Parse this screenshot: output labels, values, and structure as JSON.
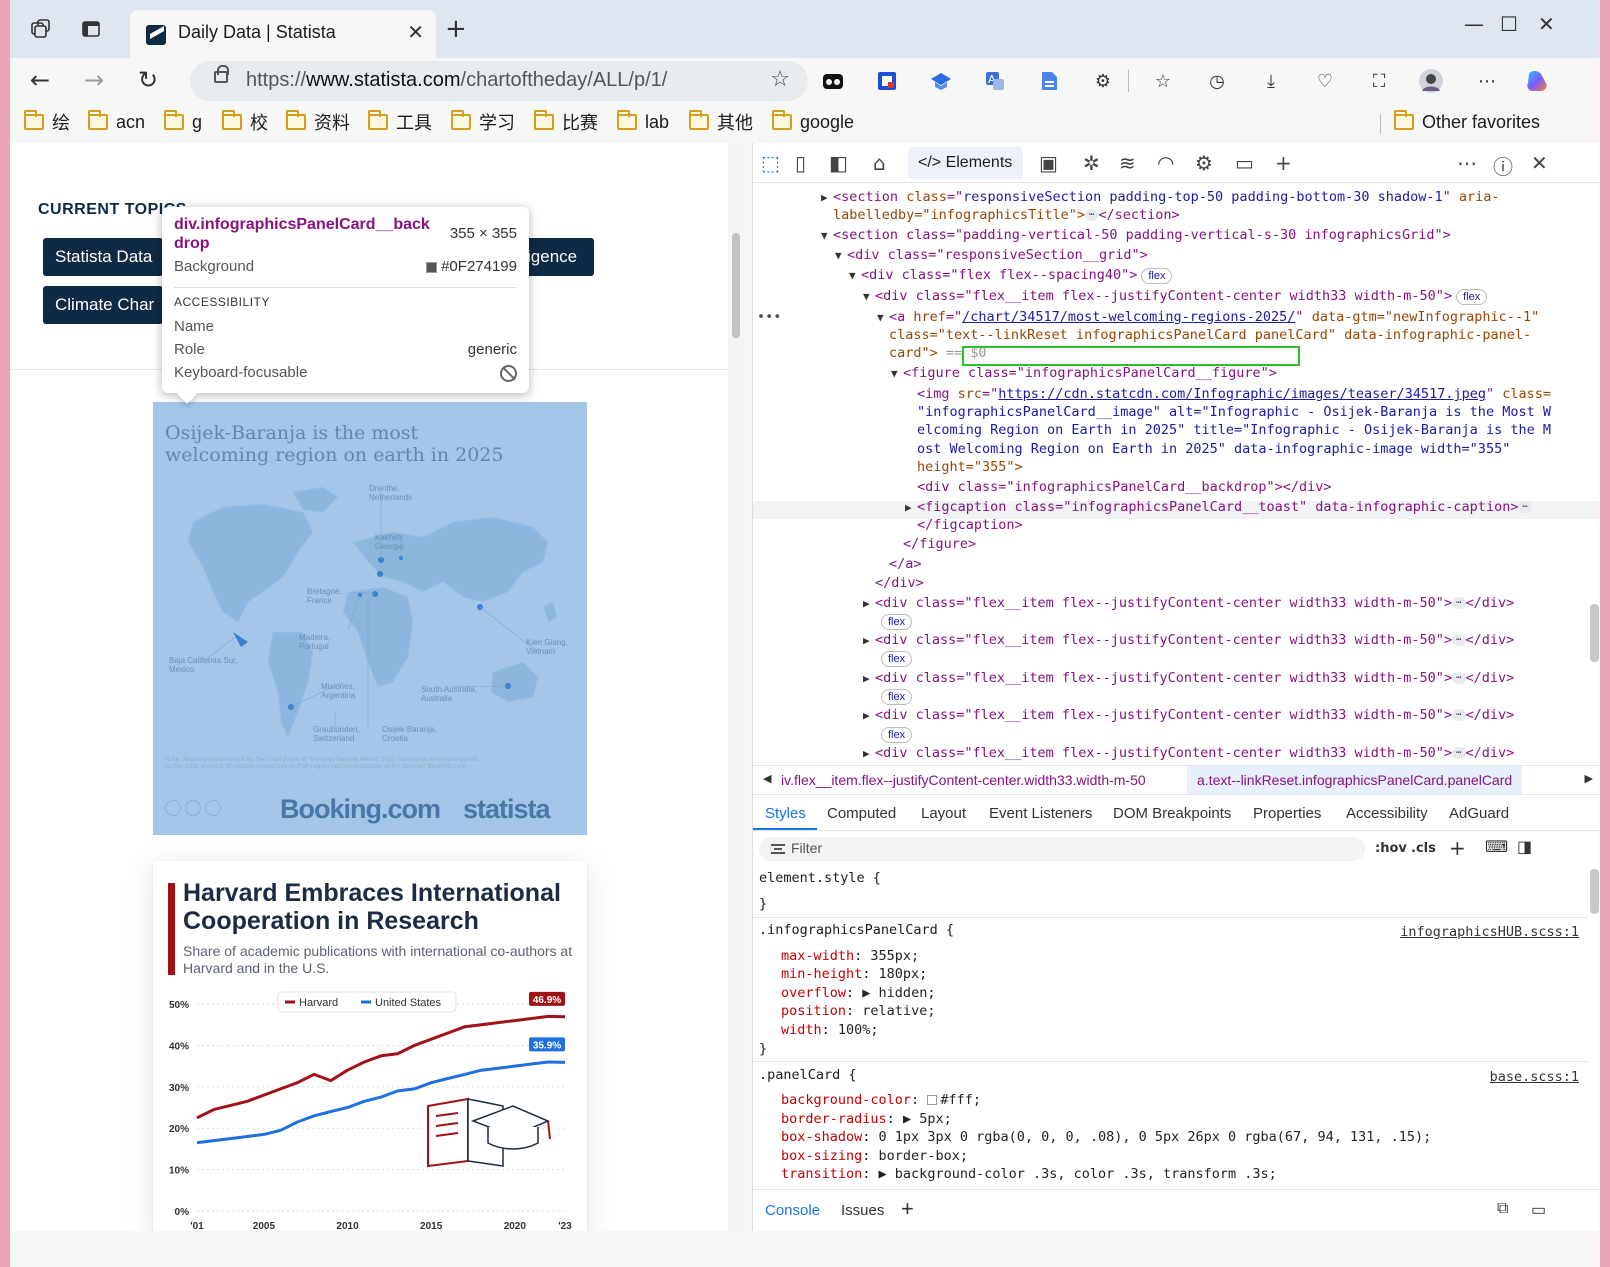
{
  "browser": {
    "tab_title": "Daily Data | Statista",
    "url_prefix": "https://",
    "url_domain": "www.statista.com",
    "url_path": "/chartoftheday/ALL/p/1/",
    "bookmarks": [
      "绘",
      "acn",
      "g",
      "校",
      "资料",
      "工具",
      "学习",
      "比赛",
      "lab",
      "其他",
      "google"
    ],
    "other_favorites": "Other favorites"
  },
  "page": {
    "topics_label": "CURRENT TOPICS",
    "topics": [
      "Statista Data",
      "elligence",
      "Climate Char"
    ],
    "card1": {
      "title": "Osijek-Baranja is the most welcoming region on earth in 2025",
      "map_labels": [
        "Drenthe, Netherlands",
        "Kakheti, Georgia",
        "Bretagne, France",
        "Madeira, Portugal",
        "Kien Giang, Vietnam",
        "Baja California Sur, Mexico",
        "Misiones, Argentina",
        "South Australia, Australia",
        "Graubünden, Switzerland",
        "Osijek-Baranja, Croatia"
      ],
      "note": "Note: Regions were sorted by the total share of Traveller Review Award 2025 recipients when compared to the total amount of eligible properties in that region (accommodation only). Source: Booking.com",
      "logo_booking": "Booking.com",
      "logo_statista": "statista"
    },
    "card2": {
      "title": "Harvard Embraces International Cooperation in Research",
      "subtitle": "Share of academic publications with international co-authors at Harvard and in the U.S."
    }
  },
  "chart_data": {
    "type": "line",
    "x": [
      2001,
      2002,
      2003,
      2004,
      2005,
      2006,
      2007,
      2008,
      2009,
      2010,
      2011,
      2012,
      2013,
      2014,
      2015,
      2016,
      2017,
      2018,
      2019,
      2020,
      2021,
      2022,
      2023
    ],
    "x_tick_labels": [
      "'01",
      "2005",
      "2010",
      "2015",
      "2020",
      "'23"
    ],
    "y_tick_labels": [
      "0%",
      "10%",
      "20%",
      "30%",
      "40%",
      "50%"
    ],
    "ylim": [
      0,
      50
    ],
    "series": [
      {
        "name": "Harvard",
        "color": "#a11217",
        "values": [
          22.5,
          24.5,
          25.5,
          26.5,
          28,
          29.5,
          31,
          33,
          31.5,
          34,
          36,
          37.5,
          38,
          40,
          41.5,
          43,
          44.5,
          45,
          45.5,
          46,
          46.5,
          47,
          46.9
        ]
      },
      {
        "name": "United States",
        "color": "#1f6fe0",
        "values": [
          16.5,
          17,
          17.5,
          18,
          18.5,
          19.5,
          21.5,
          23,
          24,
          25,
          26.5,
          27.5,
          29,
          29.5,
          31,
          32,
          33,
          34,
          34.5,
          35,
          35.5,
          36,
          35.9
        ]
      }
    ],
    "end_labels": [
      "46.9%",
      "35.9%"
    ],
    "legend_position": "top"
  },
  "tooltip": {
    "name": "div.infographicsPanelCard__backdrop",
    "size": "355 × 355",
    "bg_label": "Background",
    "bg_value": "#0F274199",
    "accessibility_label": "ACCESSIBILITY",
    "name_label": "Name",
    "role_label": "Role",
    "role_value": "generic",
    "focus_label": "Keyboard-focusable"
  },
  "devtools": {
    "elements_tab": "Elements",
    "breadcrumb_1": "iv.flex__item.flex--justifyContent-center.width33.width-m-50",
    "breadcrumb_2": "a.text--linkReset.infographicsPanelCard.panelCard",
    "subtabs": [
      "Styles",
      "Computed",
      "Layout",
      "Event Listeners",
      "DOM Breakpoints",
      "Properties",
      "Accessibility",
      "AdGuard"
    ],
    "filter_placeholder": "Filter",
    "hov": ":hov",
    "cls": ".cls",
    "drawer_tabs": [
      "Console",
      "Issues"
    ],
    "styles": {
      "element_style": "element.style {",
      "close": "}",
      "rule1_selector": ".infographicsPanelCard {",
      "rule1_source": "infographicsHUB.scss:1",
      "rule1_props": [
        {
          "name": "max-width",
          "value": "355px;"
        },
        {
          "name": "min-height",
          "value": "180px;"
        },
        {
          "name": "overflow",
          "value": "▶ hidden;"
        },
        {
          "name": "position",
          "value": "relative;"
        },
        {
          "name": "width",
          "value": "100%;"
        }
      ],
      "rule2_selector": ".panelCard {",
      "rule2_source": "base.scss:1",
      "rule2_props": [
        {
          "name": "background-color",
          "value": "#fff;"
        },
        {
          "name": "border-radius",
          "value": "▶ 5px;"
        },
        {
          "name": "box-shadow",
          "value": "0 1px 3px 0 rgba(0, 0, 0, .08), 0 5px 26px 0 rgba(67, 94, 131, .15);"
        },
        {
          "name": "box-sizing",
          "value": "border-box;"
        },
        {
          "name": "transition",
          "value": "▶ background-color .3s, color .3s, transform .3s;"
        }
      ]
    },
    "dom": {
      "l1_tag": "section",
      "l1_class": "responsiveSection padding-top-50 padding-bottom-30 shadow-1",
      "l1_extra": "aria-",
      "l1_b": "labelledby=\"infographicsTitle\">",
      "l2": "<section class=\"padding-vertical-50 padding-vertical-s-30 infographicsGrid\">",
      "l3": "<div class=\"responsiveSection__grid\">",
      "l4": "<div class=\"flex flex--spacing40\">",
      "l5": "<div class=\"flex__item flex--justifyContent-center width33 width-m-50\">",
      "a_href": "/chart/34517/most-welcoming-regions-2025/",
      "a_gtm": "data-gtm=\"newInfographic--1\"",
      "a_class_line": "class=\"text--linkReset infographicsPanelCard panelCard\" data-infographic-panel-",
      "a_end": "card\">",
      "a_eq": "== $0",
      "fig": "<figure class=\"infographicsPanelCard__figure\">",
      "img_src": "https://cdn.statcdn.com/Infographic/images/teaser/34517.jpeg",
      "img_l2": "\"infographicsPanelCard__image\" alt=\"Infographic - Osijek-Baranja is the Most W",
      "img_l3": "elcoming Region on Earth in 2025\" title=\"Infographic - Osijek-Baranja is the M",
      "img_l4": "ost Welcoming Region on Earth in 2025\" data-infographic-image width=\"355\"",
      "img_l5": "height=\"355\">",
      "backdrop": "<div class=\"infographicsPanelCard__backdrop\"></div>",
      "figcap": "<figcaption class=\"infographicsPanelCard__toast\" data-infographic-caption>",
      "figcap_end": "</figcaption>",
      "fig_end": "</figure>",
      "a_close": "</a>",
      "div_close": "</div>",
      "sibling": "<div class=\"flex__item flex--justifyContent-center width33 width-m-50\">",
      "flex": "flex"
    }
  }
}
